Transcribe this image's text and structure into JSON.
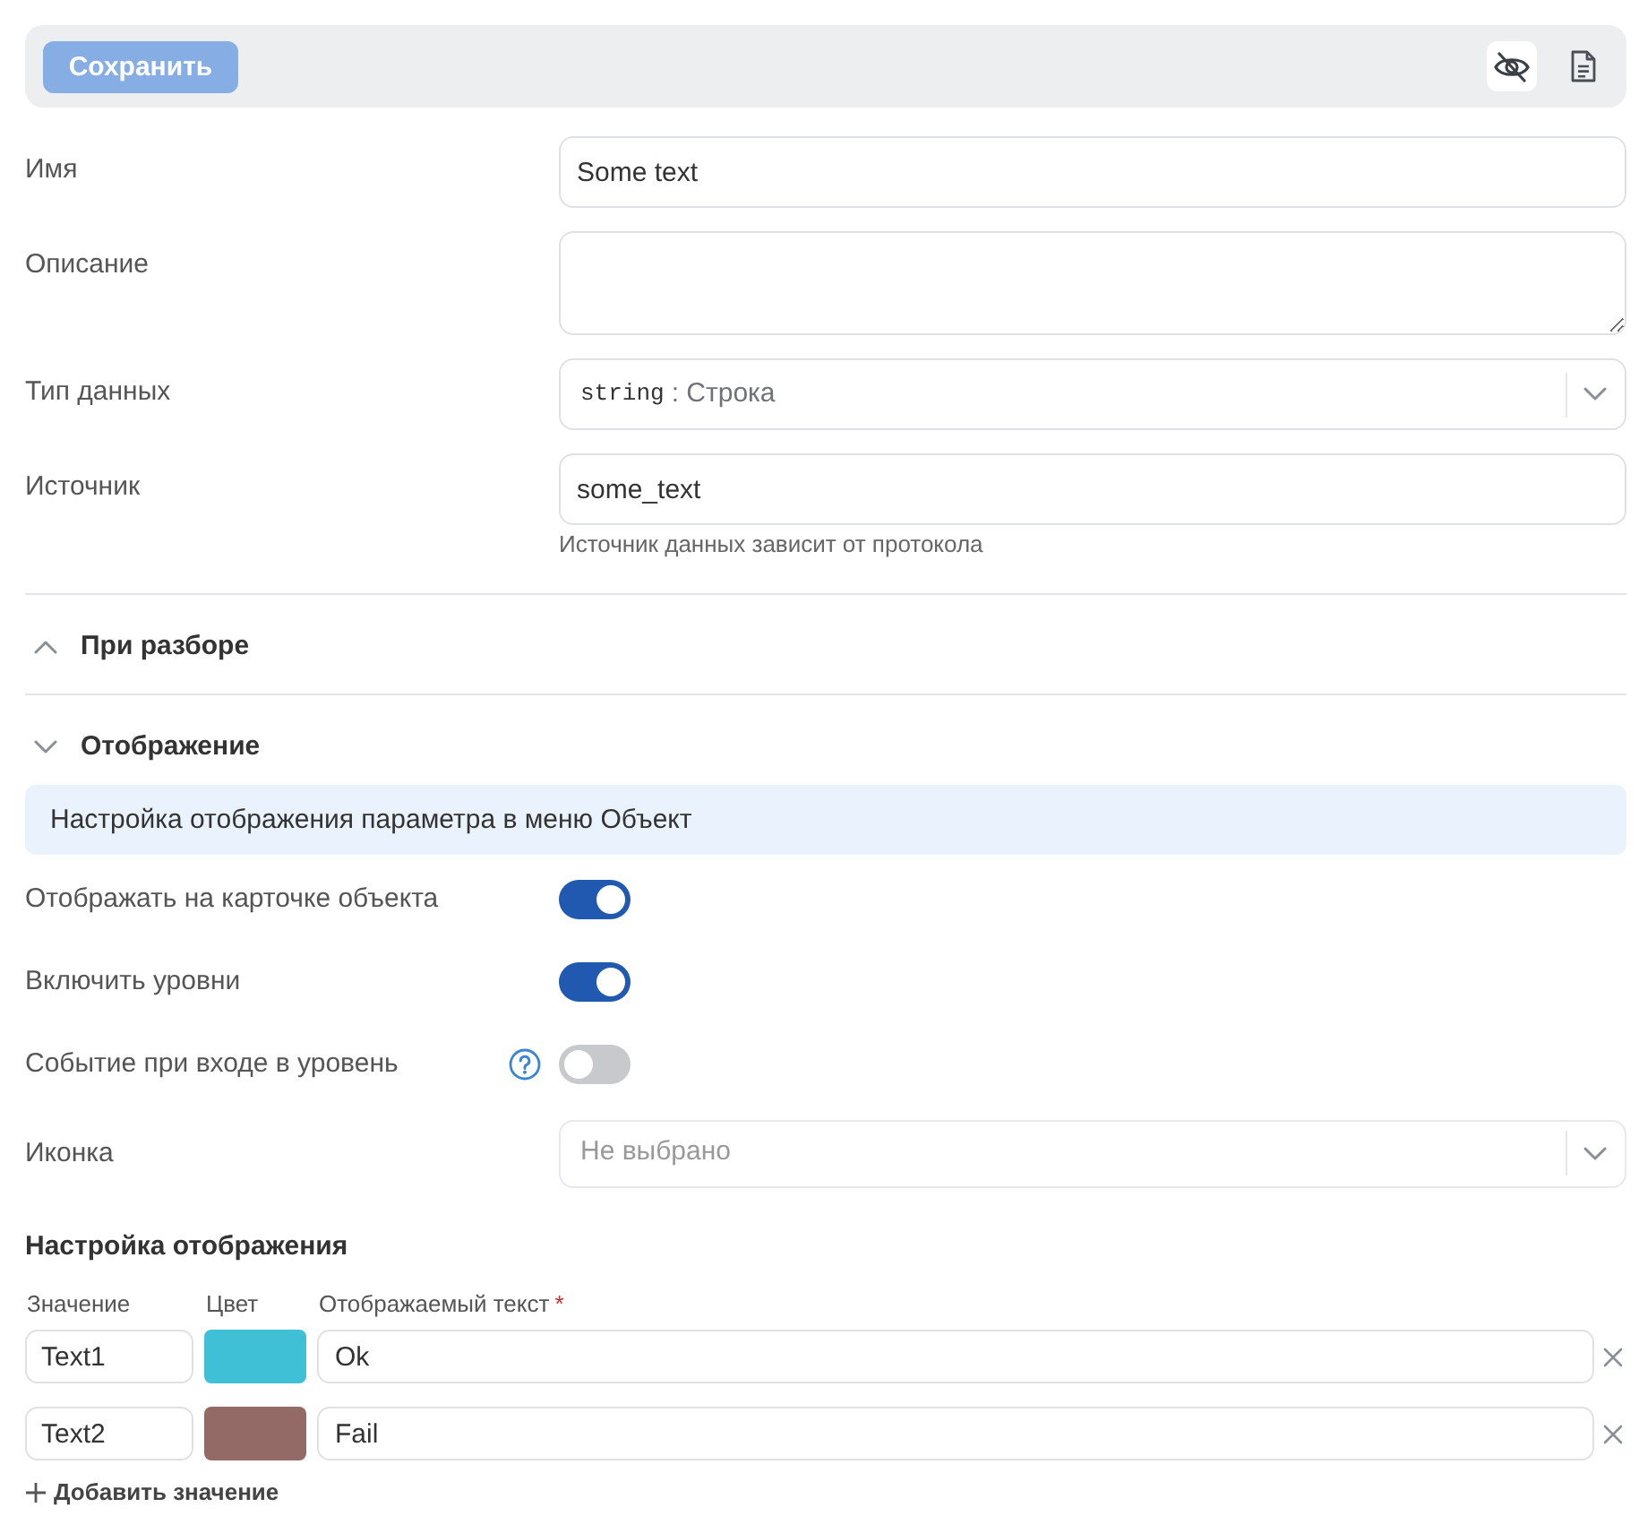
{
  "toolbar": {
    "save": {
      "label": "Сохранить",
      "disabled": true
    },
    "buttons": [
      {
        "kind": "hide",
        "selected": true
      },
      {
        "kind": "document",
        "selected": false
      }
    ]
  },
  "fields": [
    {
      "kind": "input",
      "label": "Имя",
      "value": "Some text"
    },
    {
      "kind": "textarea",
      "label": "Описание"
    },
    {
      "kind": "select",
      "label": "Тип данных",
      "code": "string",
      "value": ": Строка"
    },
    {
      "kind": "input",
      "label": "Источник",
      "value": "some_text",
      "help": "Источник данных зависит от протокола"
    }
  ],
  "sections": [
    {
      "title": "При разборе",
      "expanded": false
    },
    {
      "title": "Отображение",
      "expanded": true,
      "info": "Настройка отображения параметра в меню Объект",
      "switches": [
        {
          "label": "Отображать на карточке объекта",
          "on": true,
          "has_help": false
        },
        {
          "label": "Включить уровни",
          "on": true,
          "has_help": false
        },
        {
          "label": "Событие при входе в уровень",
          "on": false,
          "has_help": true
        }
      ],
      "icon_field": {
        "label": "Иконка",
        "placeholder": "Не выбрано"
      },
      "mapping": {
        "title": "Настройка отображения",
        "columns": [
          {
            "label": "Значение"
          },
          {
            "label": "Цвет"
          },
          {
            "label": "Отображаемый текст",
            "required_mark": "*"
          }
        ],
        "rows": [
          {
            "value": "Text1",
            "color": "#40c0d6",
            "text": "Ok"
          },
          {
            "value": "Text2",
            "color": "#946a67",
            "text": "Fail"
          }
        ],
        "add_label": "Добавить значение"
      }
    }
  ]
}
